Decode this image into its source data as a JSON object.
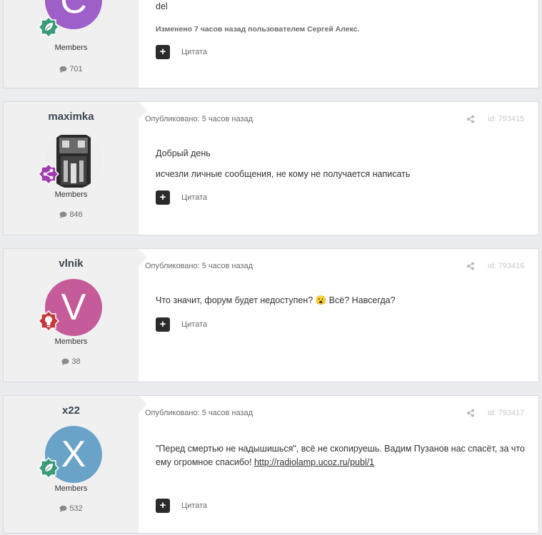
{
  "posts": [
    {
      "author": "",
      "avatar_letter": "С",
      "avatar_color": "#9e60c8",
      "badge_color": "#3a9a7a",
      "badge_icon": "leaf-icon",
      "group": "Members",
      "post_count": "701",
      "meta": "",
      "id": "",
      "body_lines": [
        "del"
      ],
      "edited": "Изменено 7 часов назад пользователем Сергей Алекс.",
      "quote_label": "Цитата"
    },
    {
      "author": "maximka",
      "avatar_letter": "",
      "avatar_color": "#9a9a9a",
      "badge_color": "#a23bb0",
      "badge_icon": "share-nodes-icon",
      "group": "Members",
      "post_count": "846",
      "meta": "Опубликовано: 5 часов назад",
      "id": "id: 793415",
      "body_lines": [
        "Добрый день",
        "исчезли личные сообщения, не кому не получается написать"
      ],
      "quote_label": "Цитата"
    },
    {
      "author": "vlnik",
      "avatar_letter": "V",
      "avatar_color": "#c55b98",
      "badge_color": "#c43a3a",
      "badge_icon": "lightbulb-icon",
      "group": "Members",
      "post_count": "38",
      "meta": "Опубликовано: 5 часов назад",
      "id": "id: 793416",
      "body_lines": [
        "Что значит, форум будет недоступен? 😮 Всё? Навсегда?"
      ],
      "quote_label": "Цитата"
    },
    {
      "author": "x22",
      "avatar_letter": "X",
      "avatar_color": "#6aa3c8",
      "badge_color": "#3a9a7a",
      "badge_icon": "leaf-icon",
      "group": "Members",
      "post_count": "532",
      "meta": "Опубликовано: 5 часов назад",
      "id": "id: 793417",
      "body_line1": "\"Перед смертью  не надышишься\", всё не скопируешь. Вадим Пузанов нас спасёт, за что",
      "body_line2_prefix": "ему огромное спасибо! ",
      "body_link": "http://radiolamp.ucoz.ru/publ/1",
      "quote_label": "Цитата"
    }
  ]
}
